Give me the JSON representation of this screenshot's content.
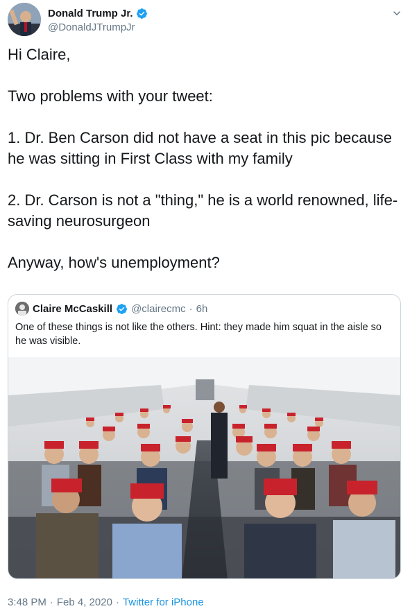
{
  "author": {
    "display_name": "Donald Trump Jr.",
    "handle": "@DonaldJTrumpJr",
    "verified": true,
    "avatar_icon": "profile-photo"
  },
  "tweet": {
    "text": "Hi Claire,\n\nTwo problems with your tweet:\n\n1. Dr. Ben Carson did not have a seat in this pic because he was sitting in First Class with my family\n\n2. Dr. Carson is not a \"thing,\" he is a world renowned, life-saving neurosurgeon\n\nAnyway, how's unemployment?"
  },
  "quoted_tweet": {
    "display_name": "Claire McCaskill",
    "handle": "@clairecmc",
    "separator": "·",
    "time": "6h",
    "verified": true,
    "text": "One of these things is not like the others. Hint: they made him squat in the aisle so he was visible."
  },
  "footer": {
    "time": "3:48 PM",
    "sep1": "·",
    "date": "Feb 4, 2020",
    "sep2": "·",
    "source": "Twitter for iPhone"
  },
  "colors": {
    "verified_blue": "#1da1f2",
    "link_blue": "#1b95e0",
    "hat_red": "#c8232c"
  }
}
